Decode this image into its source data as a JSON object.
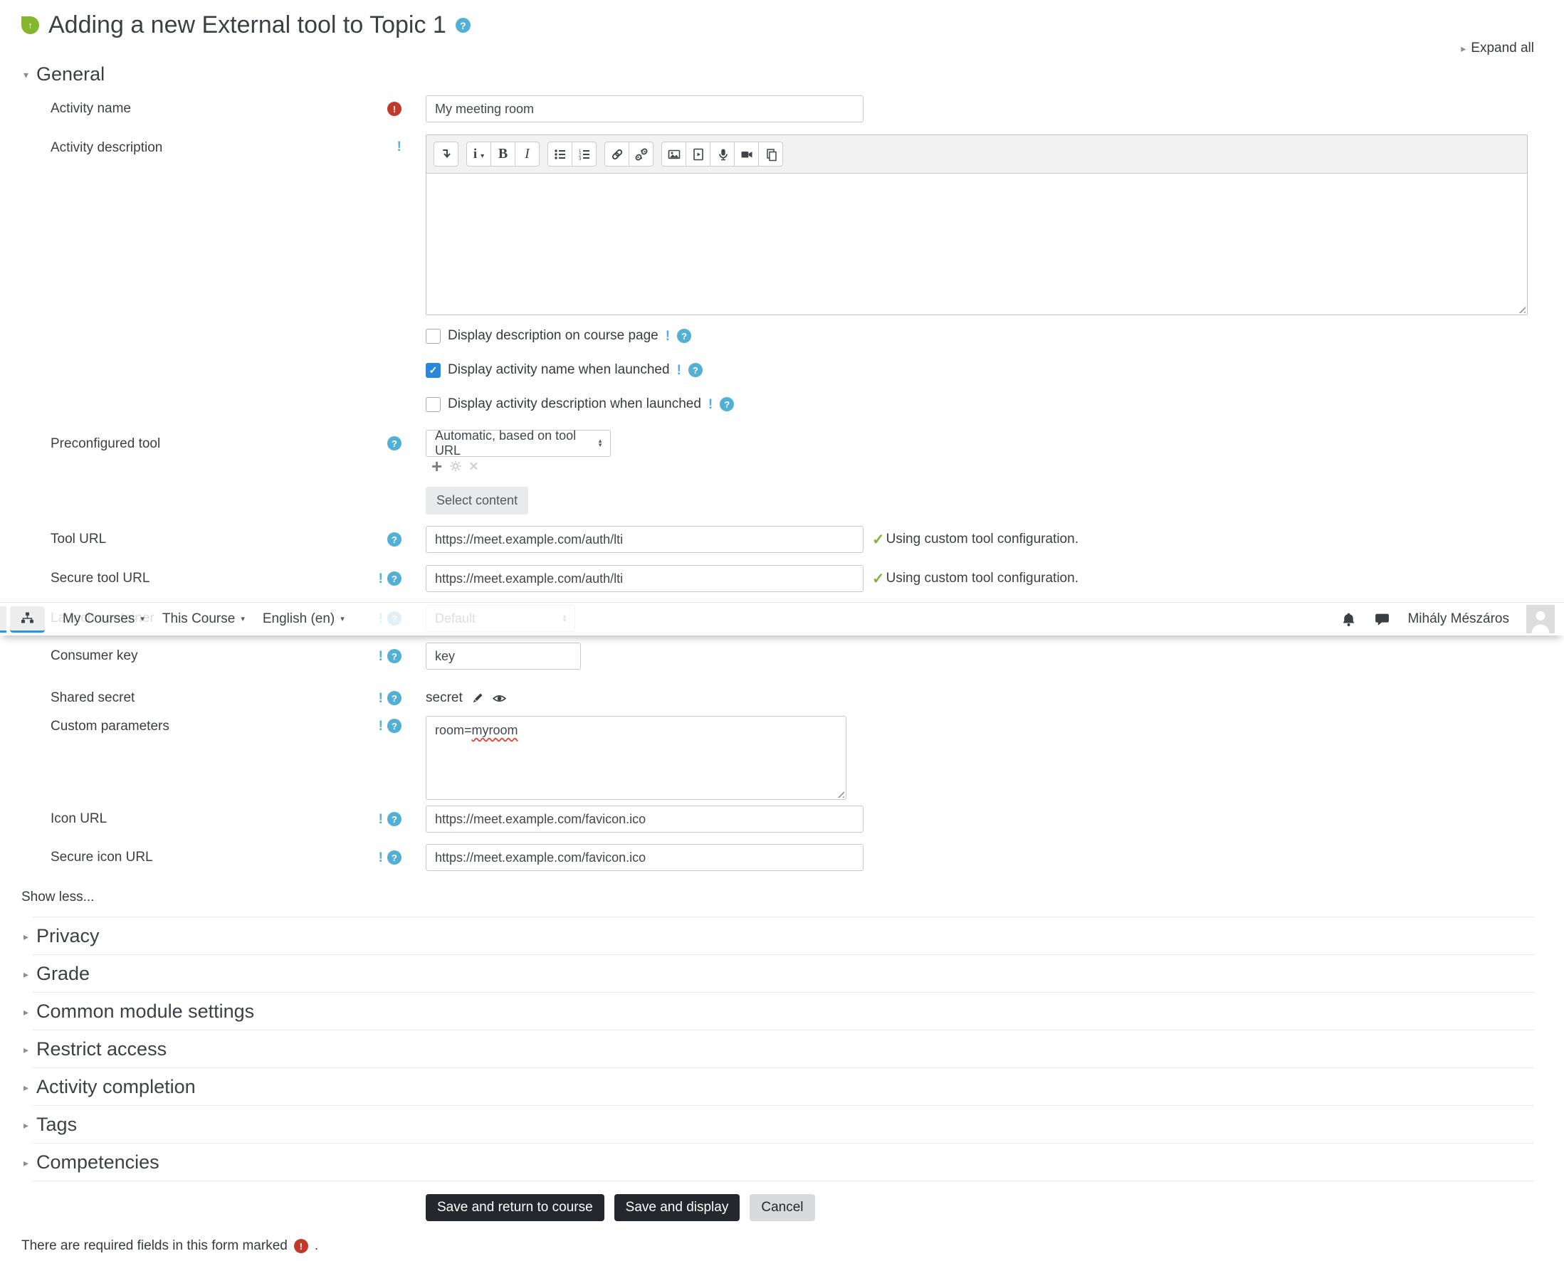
{
  "page": {
    "title": "Adding a new External tool to Topic 1",
    "expand_all": "Expand all",
    "required_note": "There are required fields in this form marked",
    "required_note_period": "."
  },
  "navbar": {
    "links": [
      {
        "label": "My Courses"
      },
      {
        "label": "This Course"
      },
      {
        "label": "English (en)"
      }
    ],
    "user_name": "Mihály Mészáros"
  },
  "general": {
    "title": "General"
  },
  "fields": {
    "activity_name": {
      "label": "Activity name",
      "value": "My meeting room"
    },
    "activity_description": {
      "label": "Activity description",
      "value": ""
    },
    "checkboxes": [
      {
        "label": "Display description on course page",
        "checked": false
      },
      {
        "label": "Display activity name when launched",
        "checked": true
      },
      {
        "label": "Display activity description when launched",
        "checked": false
      }
    ],
    "preconfigured_tool": {
      "label": "Preconfigured tool",
      "value": "Automatic, based on tool URL",
      "select_content": "Select content"
    },
    "tool_url": {
      "label": "Tool URL",
      "value": "https://meet.example.com/auth/lti",
      "status": "Using custom tool configuration."
    },
    "secure_tool_url": {
      "label": "Secure tool URL",
      "value": "https://meet.example.com/auth/lti",
      "status": "Using custom tool configuration."
    },
    "launch_container": {
      "label": "Launch container",
      "value": "Default"
    },
    "consumer_key": {
      "label": "Consumer key",
      "value": "key"
    },
    "shared_secret": {
      "label": "Shared secret",
      "value": "secret"
    },
    "custom_parameters": {
      "label": "Custom parameters",
      "value": "room=myroom",
      "prefix": "room=",
      "misspelled": "myroom"
    },
    "icon_url": {
      "label": "Icon URL",
      "value": "https://meet.example.com/favicon.ico"
    },
    "secure_icon_url": {
      "label": "Secure icon URL",
      "value": "https://meet.example.com/favicon.ico"
    },
    "show_less": "Show less..."
  },
  "collapsed_sections": [
    {
      "title": "Privacy"
    },
    {
      "title": "Grade"
    },
    {
      "title": "Common module settings"
    },
    {
      "title": "Restrict access"
    },
    {
      "title": "Activity completion"
    },
    {
      "title": "Tags"
    },
    {
      "title": "Competencies"
    }
  ],
  "buttons": {
    "save_return": "Save and return to course",
    "save_display": "Save and display",
    "cancel": "Cancel"
  },
  "editor": {
    "toolbar_icons": [
      "collapse-toolbar",
      "paragraph-styles",
      "bold",
      "italic",
      "unordered-list",
      "ordered-list",
      "link",
      "unlink",
      "image",
      "media",
      "record-audio",
      "record-video",
      "manage-files"
    ]
  },
  "colors": {
    "primary_blue": "#2b87d8",
    "nav_underline_blue": "#1b9be0",
    "help_blue": "#52b0d6",
    "required_red": "#c0392b",
    "success_green": "#7db63a",
    "tool_icon_green": "#85b72c",
    "button_dark": "#24272b"
  }
}
